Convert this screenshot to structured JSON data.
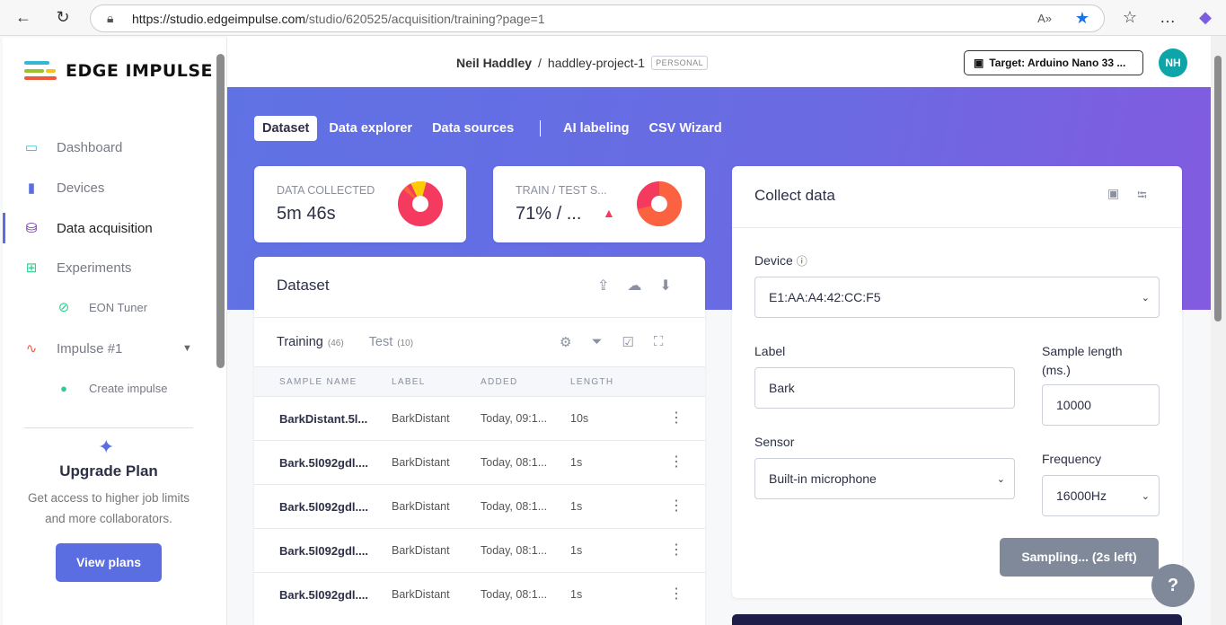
{
  "browser": {
    "url_host": "https://studio.edgeimpulse.com",
    "url_path": "/studio/620525/acquisition/training?page=1"
  },
  "sidebar": {
    "brand": "EDGE IMPULSE",
    "items": [
      {
        "label": "Dashboard"
      },
      {
        "label": "Devices"
      },
      {
        "label": "Data acquisition"
      },
      {
        "label": "Experiments"
      },
      {
        "label": "EON Tuner"
      },
      {
        "label": "Impulse #1"
      },
      {
        "label": "Create impulse"
      }
    ],
    "upgrade": {
      "title": "Upgrade Plan",
      "text": "Get access to higher job limits and more collaborators.",
      "button": "View plans"
    }
  },
  "header": {
    "user": "Neil Haddley",
    "separator": "/",
    "project": "haddley-project-1",
    "badge": "PERSONAL",
    "target": "Target: Arduino Nano 33 ...",
    "avatar": "NH"
  },
  "tabs": [
    "Dataset",
    "Data explorer",
    "Data sources",
    "AI labeling",
    "CSV Wizard"
  ],
  "stats": {
    "collected_label": "DATA COLLECTED",
    "collected_value": "5m 46s",
    "split_label": "TRAIN / TEST S...",
    "split_value": "71% / ...",
    "split_train_pct": 71
  },
  "dataset": {
    "title": "Dataset",
    "training_label": "Training",
    "training_count": "(46)",
    "test_label": "Test",
    "test_count": "(10)",
    "columns": [
      "SAMPLE NAME",
      "LABEL",
      "ADDED",
      "LENGTH"
    ],
    "rows": [
      {
        "name": "BarkDistant.5l...",
        "label": "BarkDistant",
        "added": "Today, 09:1...",
        "length": "10s"
      },
      {
        "name": "Bark.5l092gdl....",
        "label": "BarkDistant",
        "added": "Today, 08:1...",
        "length": "1s"
      },
      {
        "name": "Bark.5l092gdl....",
        "label": "BarkDistant",
        "added": "Today, 08:1...",
        "length": "1s"
      },
      {
        "name": "Bark.5l092gdl....",
        "label": "BarkDistant",
        "added": "Today, 08:1...",
        "length": "1s"
      },
      {
        "name": "Bark.5l092gdl....",
        "label": "BarkDistant",
        "added": "Today, 08:1...",
        "length": "1s"
      }
    ]
  },
  "collect": {
    "title": "Collect data",
    "device_label": "Device",
    "device_value": "E1:AA:A4:42:CC:F5",
    "label_label": "Label",
    "label_value": "Bark",
    "length_label": "Sample length (ms.)",
    "length_value": "10000",
    "sensor_label": "Sensor",
    "sensor_value": "Built-in microphone",
    "freq_label": "Frequency",
    "freq_value": "16000Hz",
    "button": "Sampling... (2s left)"
  },
  "help": "?"
}
